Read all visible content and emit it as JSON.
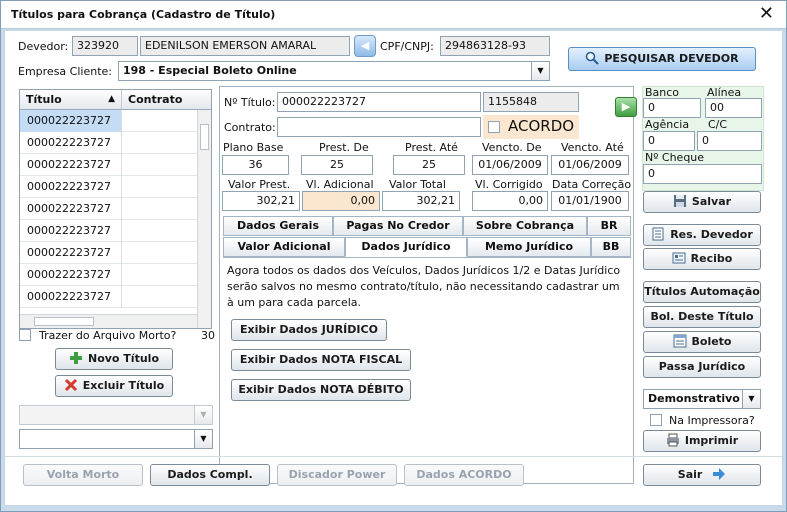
{
  "window": {
    "title": "Títulos para Cobrança (Cadastro de Título)"
  },
  "devedor": {
    "label": "Devedor:",
    "code": "323920",
    "name": "EDENILSON EMERSON AMARAL",
    "cpf_label": "CPF/CNPJ:",
    "cpf": "294863128-93",
    "search_label": "PESQUISAR DEVEDOR"
  },
  "empresa": {
    "label": "Empresa Cliente:",
    "value": "198 - Especial Boleto Online"
  },
  "list": {
    "headers": [
      "Título",
      "Contrato"
    ],
    "rows": [
      "000022223727",
      "000022223727",
      "000022223727",
      "000022223727",
      "000022223727",
      "000022223727",
      "000022223727",
      "000022223727",
      "000022223727"
    ],
    "archive_label": "Trazer do Arquivo Morto?",
    "archive_count": "30",
    "new_label": "Novo Título",
    "delete_label": "Excluir Título"
  },
  "form": {
    "titulo_label": "Nº Título:",
    "titulo": "000022223727",
    "titulo_extra": "1155848",
    "contrato_label": "Contrato:",
    "contrato": "",
    "acordo_label": "ACORDO",
    "plano_label": "Plano Base",
    "plano": "36",
    "prest_de_label": "Prest. De",
    "prest_de": "25",
    "prest_ate_label": "Prest. Até",
    "prest_ate": "25",
    "vencto_de_label": "Vencto. De",
    "vencto_de": "01/06/2009",
    "vencto_ate_label": "Vencto. Até",
    "vencto_ate": "01/06/2009",
    "valor_prest_label": "Valor Prest.",
    "valor_prest": "302,21",
    "vl_adic_label": "Vl. Adicional",
    "vl_adic": "0,00",
    "valor_total_label": "Valor Total",
    "valor_total": "302,21",
    "vl_corr_label": "Vl. Corrigido",
    "vl_corr": "0,00",
    "data_corr_label": "Data Correção",
    "data_corr": "01/01/1900"
  },
  "tabs_row1": [
    "Dados Gerais",
    "Pagas No Credor",
    "Sobre Cobrança",
    "BR"
  ],
  "tabs_row2": [
    "Valor Adicional",
    "Dados Jurídico",
    "Memo Jurídico",
    "BB"
  ],
  "tab_content": {
    "text": "Agora todos os dados dos Veículos, Dados Jurídicos 1/2 e Datas Jurídico serão salvos no mesmo contrato/título, não necessitando cadastrar um à um para cada parcela.",
    "btn1": "Exibir Dados JURÍDICO",
    "btn2": "Exibir Dados NOTA FISCAL",
    "btn3": "Exibir Dados NOTA DÉBITO"
  },
  "bank": {
    "banco_label": "Banco",
    "banco": "0",
    "alinea_label": "Alínea",
    "alinea": "00",
    "agencia_label": "Agência",
    "agencia": "0",
    "cc_label": "C/C",
    "cc": "0",
    "cheque_label": "Nº Cheque",
    "cheque": "0"
  },
  "side_buttons": {
    "salvar": "Salvar",
    "res_devedor": "Res. Devedor",
    "recibo": "Recibo",
    "titulos_automacao": "Títulos Automação",
    "bol_titulo": "Bol. Deste Título",
    "boleto": "Boleto",
    "passa_juridico": "Passa Jurídico",
    "demonstrativo": "Demonstrativo",
    "na_impressora": "Na Impressora?",
    "imprimir": "Imprimir",
    "sair": "Sair"
  },
  "bottom": {
    "volta_morto": "Volta Morto",
    "dados_compl": "Dados Compl.",
    "discador": "Discador Power",
    "dados_acordo": "Dados ACORDO"
  },
  "colors": {
    "accent_green": "#3f9e3f",
    "search_blue": "#bcd8f5",
    "peach": "#fbe7cf"
  }
}
